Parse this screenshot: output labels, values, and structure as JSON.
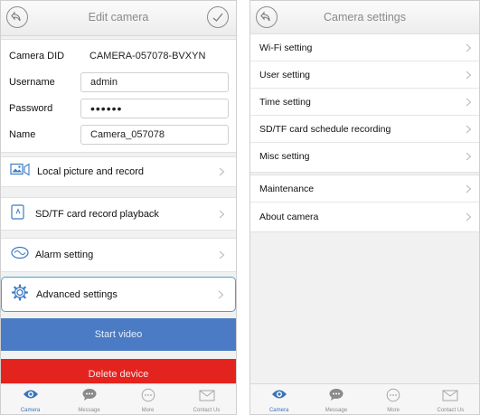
{
  "left_screen": {
    "header": {
      "title": "Edit camera"
    },
    "form": {
      "did_label": "Camera DID",
      "did_value": "CAMERA-057078-BVXYN",
      "username_label": "Username",
      "username_value": "admin",
      "password_label": "Password",
      "password_value": "••••••",
      "name_label": "Name",
      "name_value": "Camera_057078"
    },
    "menu": [
      {
        "label": "Local picture and record",
        "icon": "picture-icon"
      },
      {
        "label": "SD/TF card record playback",
        "icon": "sd-card-icon"
      },
      {
        "label": "Alarm setting",
        "icon": "alarm-icon"
      },
      {
        "label": "Advanced settings",
        "icon": "gear-icon",
        "selected": true
      }
    ],
    "start_video_label": "Start video",
    "delete_device_label": "Delete device"
  },
  "right_screen": {
    "header": {
      "title": "Camera settings"
    },
    "group1": [
      "Wi-Fi setting",
      "User setting",
      "Time setting",
      "SD/TF card schedule recording",
      "Misc setting"
    ],
    "group2": [
      "Maintenance",
      "About camera"
    ]
  },
  "tabbar": [
    {
      "label": "Camera",
      "icon": "eye-icon",
      "active": true
    },
    {
      "label": "Message",
      "icon": "chat-icon"
    },
    {
      "label": "More",
      "icon": "more-icon"
    },
    {
      "label": "Contact Us",
      "icon": "mail-icon"
    }
  ],
  "colors": {
    "start_video": "#4a7bc4",
    "delete_device": "#e3241e",
    "selection_border": "#4aa1d2",
    "tab_active": "#3a74b8"
  }
}
